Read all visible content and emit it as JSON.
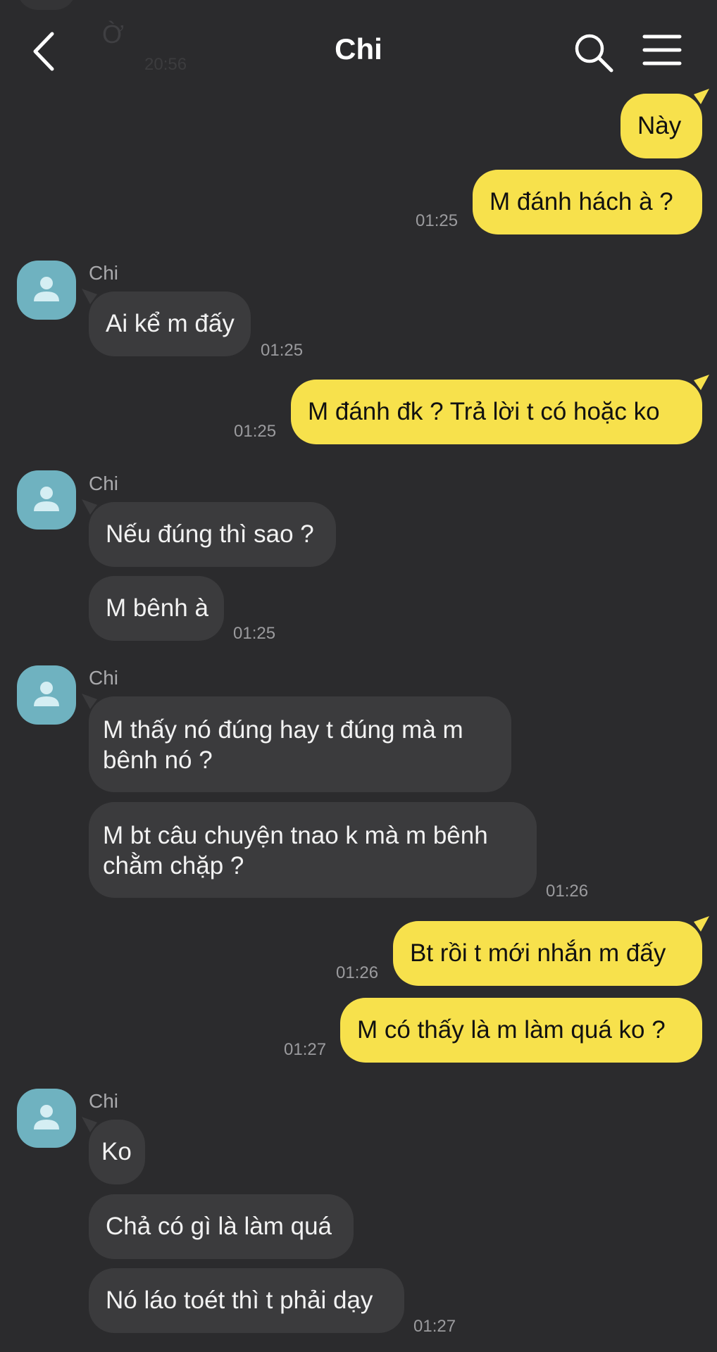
{
  "header": {
    "title": "Chi",
    "ghost_text": "Ờ",
    "ghost_time": "20:56"
  },
  "messages": {
    "m1": {
      "text": "Này"
    },
    "m2": {
      "text": "M đánh hách à ?",
      "time": "01:25"
    },
    "g1": {
      "sender": "Chi",
      "m3": "Ai kể m đấy",
      "time": "01:25"
    },
    "m4": {
      "text": "M đánh đk ? Trả lời t có hoặc ko",
      "time": "01:25"
    },
    "g2": {
      "sender": "Chi",
      "m5": "Nếu đúng thì sao ?",
      "m6": "M bênh à",
      "time": "01:25"
    },
    "g3": {
      "sender": "Chi",
      "m7_line1": "M thấy nó đúng hay t đúng mà m",
      "m7_line2": "bênh nó ?",
      "m8_line1": "M bt câu chuyện tnao k mà m bênh",
      "m8_line2": "chằm chặp ?",
      "time": "01:26"
    },
    "m9": {
      "text": "Bt rồi t mới nhắn m đấy",
      "time": "01:26"
    },
    "m10": {
      "text": "M có thấy là m làm quá ko ?",
      "time": "01:27"
    },
    "g4": {
      "sender": "Chi",
      "m11": "Ko",
      "m12": "Chả có gì là làm quá",
      "m13": "Nó láo toét thì t phải dạy",
      "time": "01:27"
    }
  },
  "colors": {
    "background": "#2b2b2d",
    "outgoing_bubble": "#f7e14c",
    "incoming_bubble": "#3b3b3d",
    "avatar": "#6fb2c0"
  },
  "icons": {
    "back": "chevron-left-icon",
    "search": "search-icon",
    "menu": "hamburger-menu-icon",
    "avatar": "person-icon"
  }
}
